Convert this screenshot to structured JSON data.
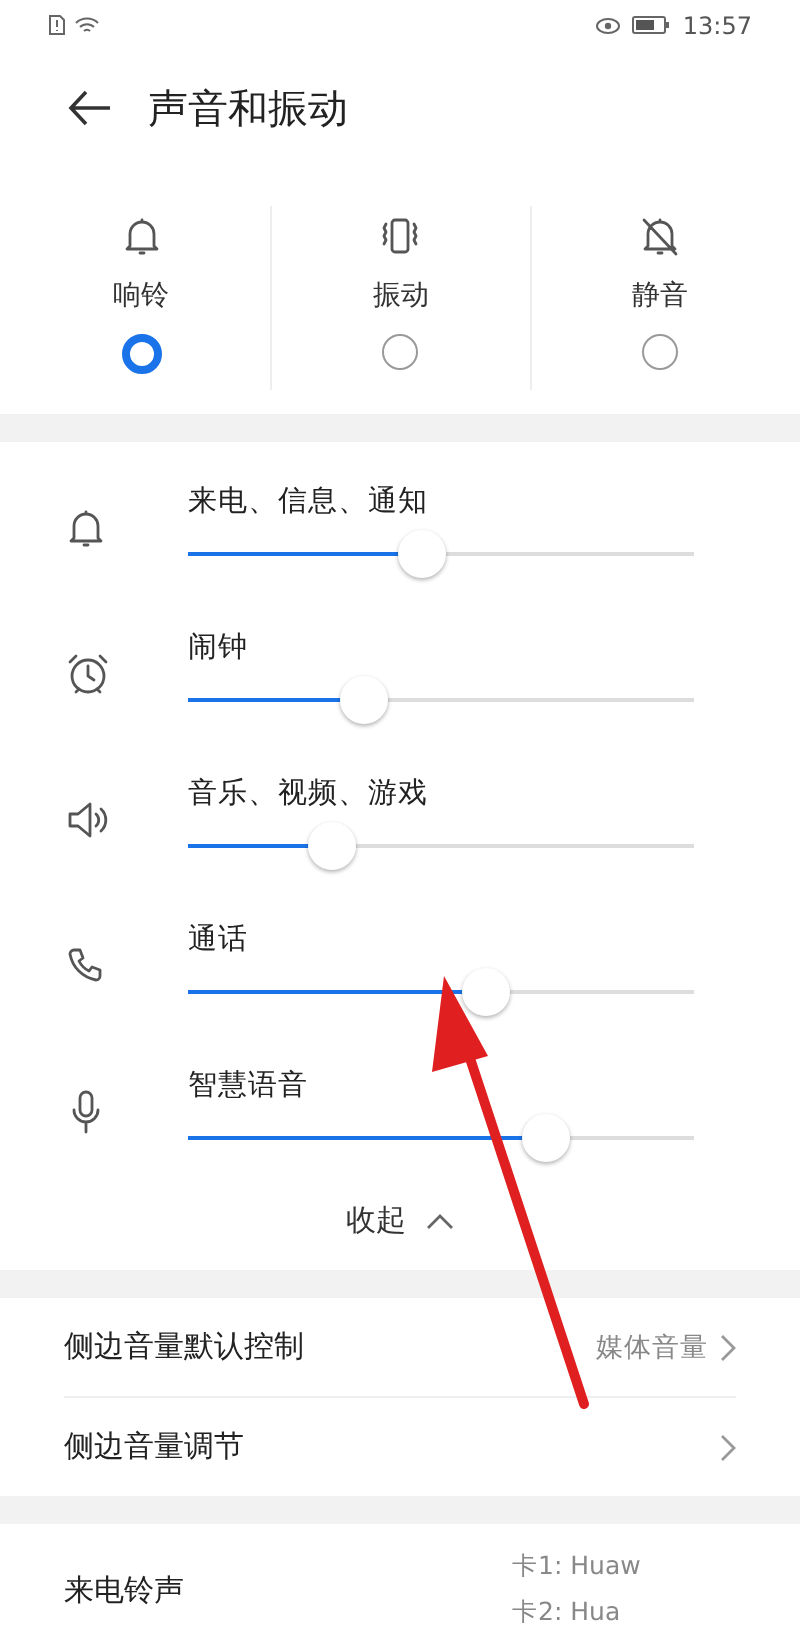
{
  "status_bar": {
    "time": "13:57"
  },
  "header": {
    "title": "声音和振动"
  },
  "modes": [
    {
      "kind": "ring",
      "label": "响铃",
      "selected": true
    },
    {
      "kind": "vibrate",
      "label": "振动",
      "selected": false
    },
    {
      "kind": "silent",
      "label": "静音",
      "selected": false
    }
  ],
  "volumes": [
    {
      "kind": "bell",
      "label": "来电、信息、通知",
      "level": 0.46
    },
    {
      "kind": "alarm",
      "label": "闹钟",
      "level": 0.33
    },
    {
      "kind": "speaker",
      "label": "音乐、视频、游戏",
      "level": 0.26
    },
    {
      "kind": "phone",
      "label": "通话",
      "level": 0.6
    },
    {
      "kind": "mic",
      "label": "智慧语音",
      "level": 0.73
    }
  ],
  "collapse": {
    "label": "收起"
  },
  "settings": [
    {
      "label": "侧边音量默认控制",
      "value": "媒体音量"
    },
    {
      "label": "侧边音量调节"
    }
  ],
  "ringtone": {
    "label": "来电铃声",
    "cards": [
      "卡1: Huaw",
      "卡2: Hua"
    ]
  }
}
